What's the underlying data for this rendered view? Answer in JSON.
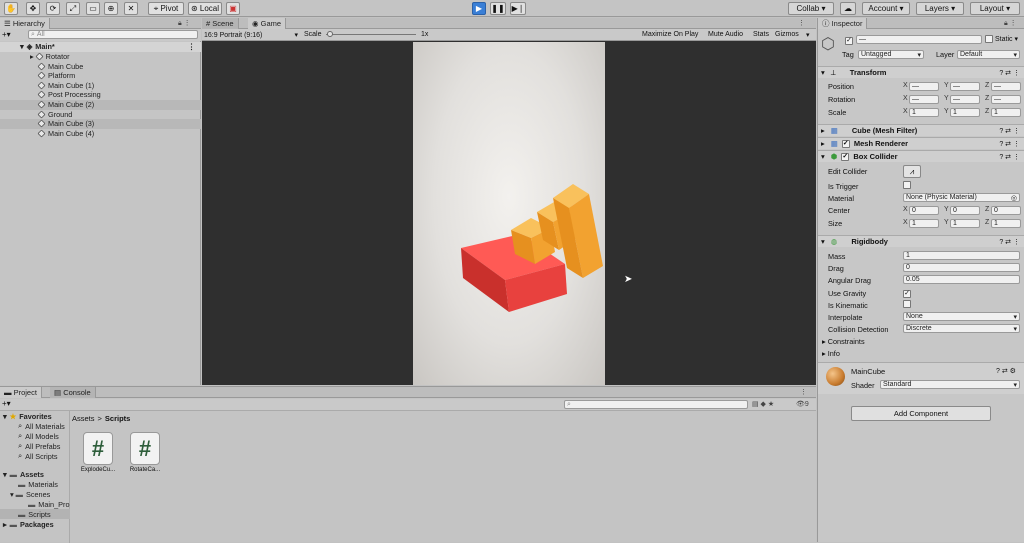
{
  "toolbar": {
    "pivot": "Pivot",
    "local": "Local",
    "collab": "Collab",
    "account": "Account",
    "layers": "Layers",
    "layout": "Layout"
  },
  "hierarchy": {
    "tab": "Hierarchy",
    "search_placeholder": "All",
    "root": "Main*",
    "items": [
      "Rotator",
      "Main Cube",
      "Platform",
      "Main Cube (1)",
      "Post Processing",
      "Main Cube (2)",
      "Ground",
      "Main Cube (3)",
      "Main Cube (4)"
    ]
  },
  "game": {
    "tab_scene": "Scene",
    "tab_game": "Game",
    "aspect": "16:9 Portrait (9:16)",
    "scale_label": "Scale",
    "scale_value": "1x",
    "maximize": "Maximize On Play",
    "mute": "Mute Audio",
    "stats": "Stats",
    "gizmos": "Gizmos"
  },
  "inspector": {
    "tab": "Inspector",
    "name": "—",
    "static": "Static",
    "tag_label": "Tag",
    "tag": "Untagged",
    "layer_label": "Layer",
    "layer": "Default",
    "transform": {
      "title": "Transform",
      "position": "Position",
      "rotation": "Rotation",
      "scale": "Scale",
      "pos": [
        "—",
        "—",
        "—"
      ],
      "rot": [
        "—",
        "—",
        "—"
      ],
      "scl": [
        "1",
        "1",
        "1"
      ]
    },
    "mesh_filter": "Cube (Mesh Filter)",
    "mesh_renderer": "Mesh Renderer",
    "box_collider": {
      "title": "Box Collider",
      "edit": "Edit Collider",
      "is_trigger": "Is Trigger",
      "material_label": "Material",
      "material": "None (Physic Material)",
      "center": "Center",
      "center_vals": [
        "0",
        "0",
        "0"
      ],
      "size": "Size",
      "size_vals": [
        "1",
        "1",
        "1"
      ]
    },
    "rigidbody": {
      "title": "Rigidbody",
      "mass_label": "Mass",
      "mass": "1",
      "drag_label": "Drag",
      "drag": "0",
      "ang_label": "Angular Drag",
      "ang": "0.05",
      "gravity": "Use Gravity",
      "kinematic": "Is Kinematic",
      "interp_label": "Interpolate",
      "interp": "None",
      "coll_label": "Collision Detection",
      "coll": "Discrete",
      "constraints": "Constraints",
      "info": "Info"
    },
    "material": {
      "name": "MainCube",
      "shader_label": "Shader",
      "shader": "Standard"
    },
    "add_component": "Add Component"
  },
  "project": {
    "tab_project": "Project",
    "tab_console": "Console",
    "breadcrumb_root": "Assets",
    "breadcrumb_sep": ">",
    "breadcrumb_leaf": "Scripts",
    "count": "9",
    "favorites": "Favorites",
    "fav_items": [
      "All Materials",
      "All Models",
      "All Prefabs",
      "All Scripts"
    ],
    "assets": "Assets",
    "asset_items": [
      "Materials",
      "Scenes",
      "Main_Pro",
      "Scripts"
    ],
    "packages": "Packages",
    "files": [
      "ExplodeCu...",
      "RotateCa..."
    ]
  },
  "colors": {
    "red": "#e8413e",
    "orange": "#f2a230",
    "blue": "#3a7fd6"
  }
}
